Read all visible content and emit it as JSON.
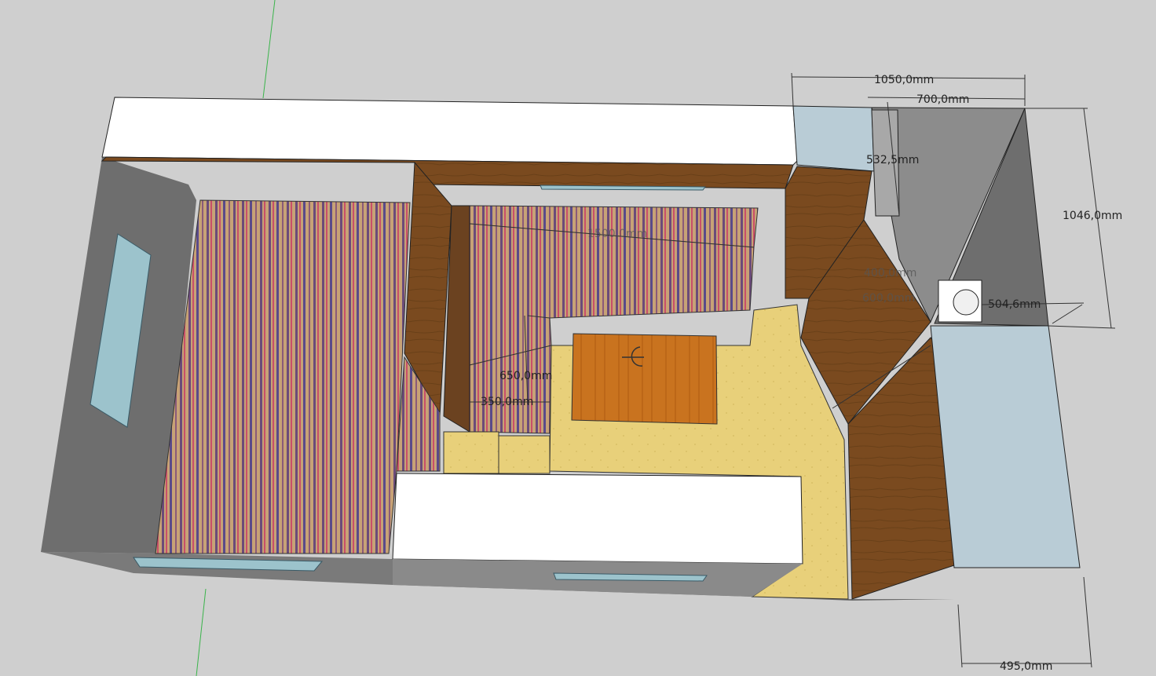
{
  "dimensions": {
    "d1050": "1050,0mm",
    "d700": "700,0mm",
    "d532": "532,5mm",
    "d1046": "1046,0mm",
    "d504": "504,6mm",
    "d495": "495,0mm",
    "d650": "650,0mm",
    "d350": "350,0mm",
    "d1500": "1500,0mm",
    "d400": "400,0mm",
    "d600": "600,0mm"
  },
  "colors": {
    "background": "#cfcfcf",
    "wall_top": "#ffffff",
    "wall_side": "#6e6e6e",
    "wood": "#7a4a1f",
    "floor": "#e8d07a",
    "glass": "#b9ccd6",
    "table": "#c9731f"
  }
}
